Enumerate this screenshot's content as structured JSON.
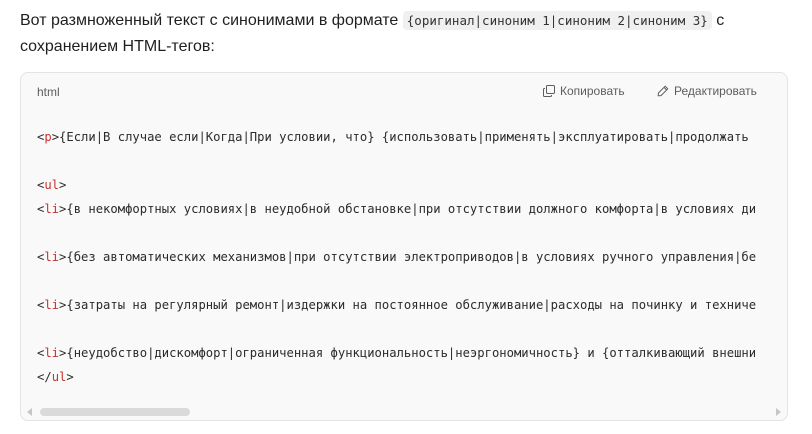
{
  "intro": {
    "text_before": "Вот размноженный текст с синонимами в формате ",
    "inline_code": "{оригинал|синоним 1|синоним 2|синоним 3}",
    "text_after": " с сохранением HTML-тегов:"
  },
  "code_block": {
    "language": "html",
    "copy_icon": "copy-icon",
    "copy_label": "Копировать",
    "edit_icon": "pencil-icon",
    "edit_label": "Редактировать",
    "lines": {
      "l1": {
        "open": "<",
        "tag": "p",
        "close": ">",
        "text": "{Если|В случае если|Когда|При условии, что} {использовать|применять|эксплуатировать|продолжать"
      },
      "l2": {
        "open": "<",
        "tag": "ul",
        "close": ">"
      },
      "l3": {
        "open": "<",
        "tag": "li",
        "close": ">",
        "text": "{в некомфортных условиях|в неудобной обстановке|при отсутствии должного комфорта|в условиях ди"
      },
      "l4": {
        "open": "<",
        "tag": "li",
        "close": ">",
        "text": "{без автоматических механизмов|при отсутствии электроприводов|в условиях ручного управления|бе"
      },
      "l5": {
        "open": "<",
        "tag": "li",
        "close": ">",
        "text": "{затраты на регулярный ремонт|издержки на постоянное обслуживание|расходы на починку и техниче"
      },
      "l6": {
        "open": "<",
        "tag": "li",
        "close": ">",
        "text": "{неудобство|дискомфорт|ограниченная функциональность|неэргономичность} и {отталкивающий внешни"
      },
      "l7": {
        "open": "</",
        "tag": "ul",
        "close": ">"
      }
    }
  },
  "colors": {
    "tag_name": "#c8322c",
    "code_background": "#f9f9f9",
    "border": "#e3e3e3"
  }
}
